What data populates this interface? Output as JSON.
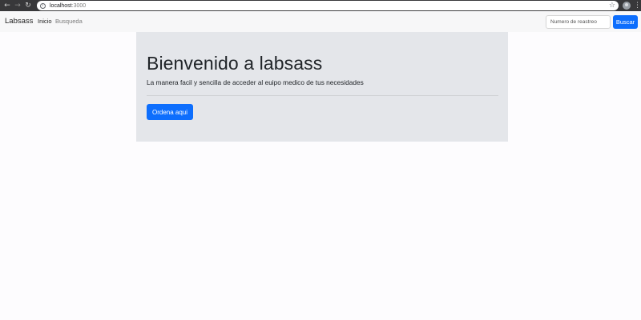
{
  "browser": {
    "url_host": "localhost",
    "url_port": ":3000",
    "icons": [
      "back-arrow-icon",
      "forward-arrow-icon",
      "reload-icon",
      "info-icon",
      "star-icon",
      "profile-icon",
      "menu-dots-icon"
    ]
  },
  "navbar": {
    "brand": "Labsass",
    "links": [
      {
        "label": "Inicio",
        "active": true
      },
      {
        "label": "Busqueda",
        "active": false
      }
    ],
    "search": {
      "placeholder": "Numero de reastreo",
      "button_label": "Buscar"
    }
  },
  "jumbotron": {
    "title": "Bienvenido a labsass",
    "lead": "La manera facil y sencilla de acceder al euipo medico de tus necesidades",
    "button_label": "Ordena aqui"
  },
  "colors": {
    "primary": "#0d6efd",
    "navbar_bg": "#f7f7f8",
    "jumbotron_bg": "#e4e6ea",
    "chrome_bg": "#38383a"
  }
}
